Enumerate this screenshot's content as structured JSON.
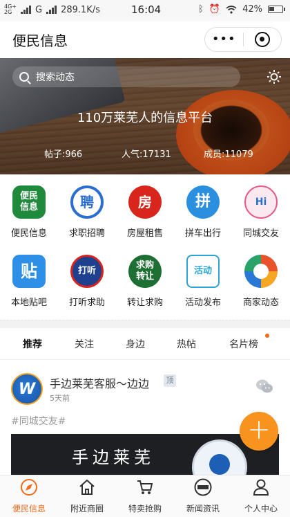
{
  "status_bar": {
    "network_top": "4G+",
    "network_bottom": "2G",
    "carrier": "G",
    "speed": "289.1K/s",
    "time": "16:04",
    "battery": "42%",
    "battery_level": 0.42
  },
  "header": {
    "title": "便民信息",
    "menu_dots": "•••"
  },
  "banner": {
    "search_placeholder": "搜索动态",
    "tagline": "110万莱芜人的信息平台",
    "stats": {
      "posts": "帖子:966",
      "popularity": "人气:17131",
      "members": "成员:11079"
    }
  },
  "categories": [
    {
      "label": "便民信息",
      "icon_text": "便民\n信息",
      "icon": "bianmin-icon",
      "color": "#1f8a3b"
    },
    {
      "label": "求职招聘",
      "icon_text": "聘",
      "icon": "recruit-icon",
      "color": "#2a6fcf"
    },
    {
      "label": "房屋租售",
      "icon_text": "房",
      "icon": "house-icon",
      "color": "#d9261c"
    },
    {
      "label": "拼车出行",
      "icon_text": "拼",
      "icon": "carpool-icon",
      "color": "#2b8fe0"
    },
    {
      "label": "同城交友",
      "icon_text": "Hi",
      "icon": "friends-icon",
      "color": "#f4f4f4"
    },
    {
      "label": "本地贴吧",
      "icon_text": "贴",
      "icon": "tieba-icon",
      "color": "#2e8fe6"
    },
    {
      "label": "打听求助",
      "icon_text": "打听",
      "icon": "inquire-icon",
      "color": "#1f3f8f"
    },
    {
      "label": "转让求购",
      "icon_text": "求购\n转让",
      "icon": "transfer-icon",
      "color": "#1e6f34"
    },
    {
      "label": "活动发布",
      "icon_text": "活动",
      "icon": "activity-icon",
      "color": "#2aa3d6"
    },
    {
      "label": "商家动态",
      "icon_text": "",
      "icon": "merchant-icon",
      "color": "#e8532c"
    }
  ],
  "tabs": [
    {
      "label": "推荐",
      "active": true
    },
    {
      "label": "关注",
      "active": false
    },
    {
      "label": "身边",
      "active": false
    },
    {
      "label": "热帖",
      "active": false
    },
    {
      "label": "名片榜",
      "active": false
    }
  ],
  "post": {
    "author": "手边莱芜客服～边边",
    "top_badge": "顶",
    "time": "5天前",
    "hashtag": "#同城交友#",
    "image_text": "手边莱芜",
    "avatar_text": "W"
  },
  "fab": {
    "label": "+"
  },
  "bottom_nav": [
    {
      "label": "便民信息",
      "icon": "compass-icon",
      "active": true
    },
    {
      "label": "附近商圈",
      "icon": "home-icon",
      "active": false
    },
    {
      "label": "特卖抢购",
      "icon": "cart-icon",
      "active": false
    },
    {
      "label": "新闻资讯",
      "icon": "news-icon",
      "active": false
    },
    {
      "label": "个人中心",
      "icon": "user-icon",
      "active": false
    }
  ],
  "colors": {
    "accent": "#f26b1d",
    "fab": "#f7931e"
  }
}
